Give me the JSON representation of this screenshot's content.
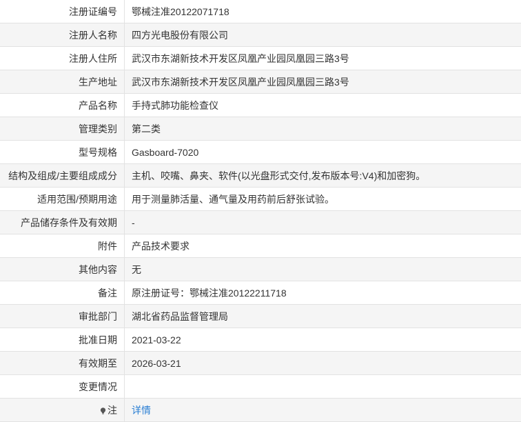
{
  "rows": [
    {
      "label": "注册证编号",
      "value": "鄂械注准20122071718"
    },
    {
      "label": "注册人名称",
      "value": "四方光电股份有限公司"
    },
    {
      "label": "注册人住所",
      "value": "武汉市东湖新技术开发区凤凰产业园凤凰园三路3号"
    },
    {
      "label": "生产地址",
      "value": "武汉市东湖新技术开发区凤凰产业园凤凰园三路3号"
    },
    {
      "label": "产品名称",
      "value": "手持式肺功能检查仪"
    },
    {
      "label": "管理类别",
      "value": "第二类"
    },
    {
      "label": "型号规格",
      "value": "Gasboard-7020"
    },
    {
      "label": "结构及组成/主要组成成分",
      "value": "主机、咬嘴、鼻夹、软件(以光盘形式交付,发布版本号:V4)和加密狗。"
    },
    {
      "label": "适用范围/预期用途",
      "value": "用于测量肺活量、通气量及用药前后舒张试验。"
    },
    {
      "label": "产品储存条件及有效期",
      "value": "-"
    },
    {
      "label": "附件",
      "value": "产品技术要求"
    },
    {
      "label": "其他内容",
      "value": "无"
    },
    {
      "label": "备注",
      "value": "原注册证号：鄂械注准20122211718"
    },
    {
      "label": "审批部门",
      "value": "湖北省药品监督管理局"
    },
    {
      "label": "批准日期",
      "value": "2021-03-22"
    },
    {
      "label": "有效期至",
      "value": "2026-03-21"
    },
    {
      "label": "变更情况",
      "value": ""
    }
  ],
  "note": {
    "label": "注",
    "icon": "lightbulb-icon",
    "link_text": "详情",
    "link_color": "#2a7fd4"
  }
}
